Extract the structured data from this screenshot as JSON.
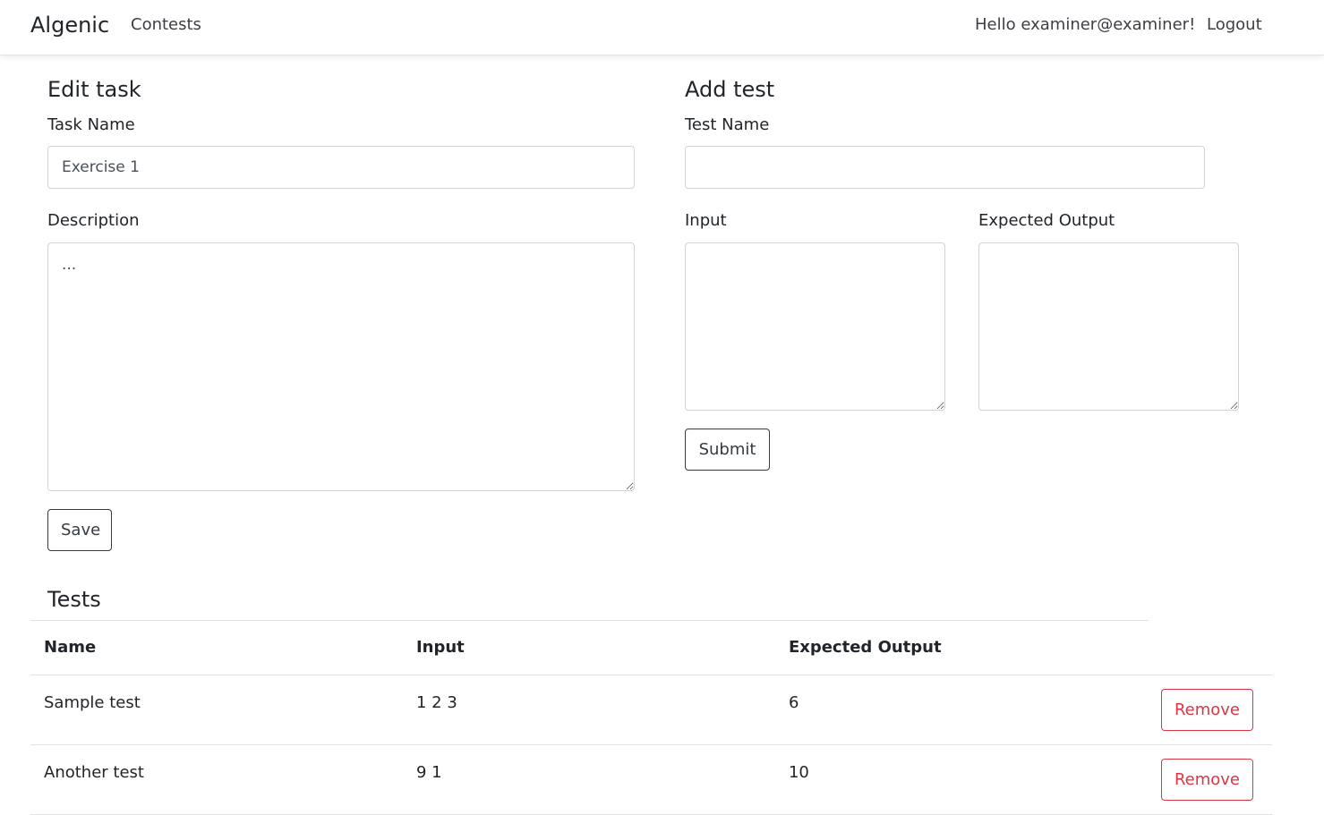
{
  "navbar": {
    "brand": "Algenic",
    "contests_link": "Contests",
    "greeting": "Hello examiner@examiner!",
    "logout_link": "Logout"
  },
  "edit_task": {
    "heading": "Edit task",
    "task_name_label": "Task Name",
    "task_name_value": "Exercise 1",
    "description_label": "Description",
    "description_value": "...",
    "save_label": "Save"
  },
  "add_test": {
    "heading": "Add test",
    "test_name_label": "Test Name",
    "test_name_value": "",
    "input_label": "Input",
    "input_value": "",
    "expected_output_label": "Expected Output",
    "expected_output_value": "",
    "submit_label": "Submit"
  },
  "tests": {
    "heading": "Tests",
    "columns": [
      "Name",
      "Input",
      "Expected Output"
    ],
    "rows": [
      {
        "name": "Sample test",
        "input": "1 2 3",
        "expected_output": "6",
        "action_label": "Remove"
      },
      {
        "name": "Another test",
        "input": "9 1",
        "expected_output": "10",
        "action_label": "Remove"
      }
    ]
  },
  "colors": {
    "danger": "#dc3545",
    "dark": "#343a40",
    "border": "#ced4da"
  }
}
